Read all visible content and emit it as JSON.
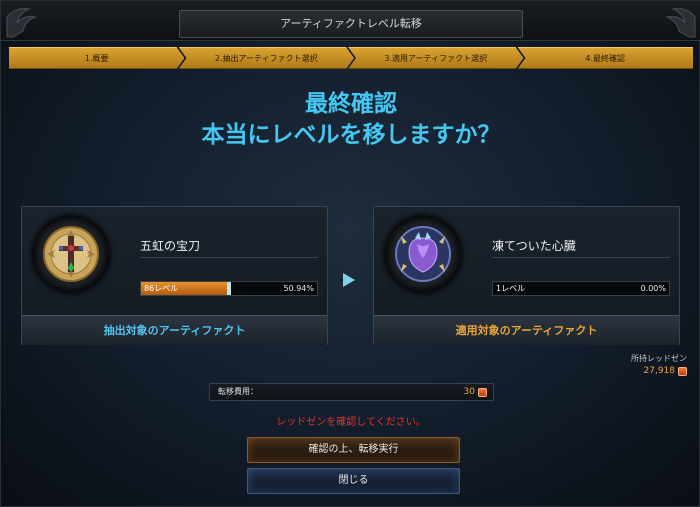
{
  "window": {
    "title": "アーティファクトレベル転移"
  },
  "steps": [
    {
      "label": "1.概要"
    },
    {
      "label": "2.抽出アーティファクト選択"
    },
    {
      "label": "3.適用アーティファクト選択"
    },
    {
      "label": "4.最終確認"
    }
  ],
  "heading": {
    "line1": "最終確認",
    "line2": "本当にレベルを移しますか？"
  },
  "source": {
    "name": "五虹の宝刀",
    "level_label": "86レベル",
    "progress_text": "50.94%",
    "progress_fraction": 0.5094,
    "footer": "抽出対象のアーティファクト",
    "icon": "sword-emblem-icon"
  },
  "target": {
    "name": "凍てついた心臓",
    "level_label": "1レベル",
    "progress_text": "0.00%",
    "progress_fraction": 0.0,
    "footer": "適用対象のアーティファクト",
    "icon": "frozen-heart-icon"
  },
  "owned": {
    "label": "所持レッドゼン",
    "value": "27,918"
  },
  "fee": {
    "label": "転移費用：",
    "value": "30"
  },
  "warning": "レッドゼンを確認してください。",
  "buttons": {
    "confirm": "確認の上、転移実行",
    "close": "閉じる"
  },
  "colors": {
    "accent_blue": "#44c8f2",
    "accent_gold": "#e8a63a",
    "warning_red": "#e5342a",
    "step_gold": "#d9a231"
  }
}
